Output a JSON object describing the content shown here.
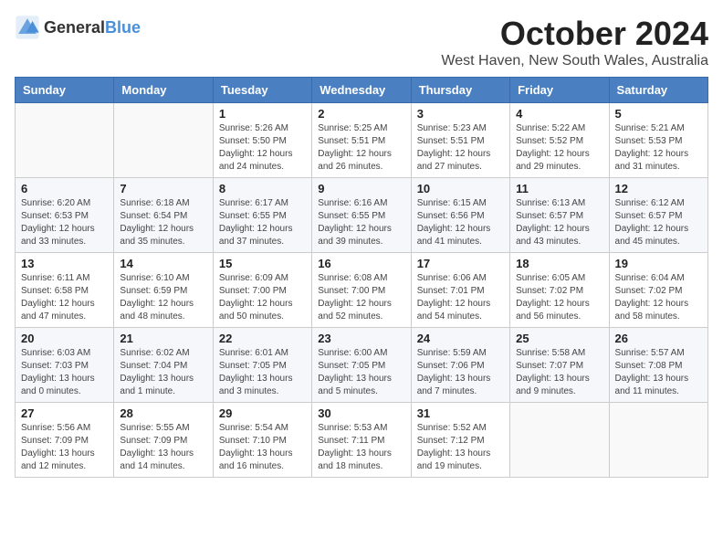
{
  "logo": {
    "text_general": "General",
    "text_blue": "Blue"
  },
  "header": {
    "month_title": "October 2024",
    "location": "West Haven, New South Wales, Australia"
  },
  "days_of_week": [
    "Sunday",
    "Monday",
    "Tuesday",
    "Wednesday",
    "Thursday",
    "Friday",
    "Saturday"
  ],
  "weeks": [
    [
      {
        "day": "",
        "info": ""
      },
      {
        "day": "",
        "info": ""
      },
      {
        "day": "1",
        "info": "Sunrise: 5:26 AM\nSunset: 5:50 PM\nDaylight: 12 hours and 24 minutes."
      },
      {
        "day": "2",
        "info": "Sunrise: 5:25 AM\nSunset: 5:51 PM\nDaylight: 12 hours and 26 minutes."
      },
      {
        "day": "3",
        "info": "Sunrise: 5:23 AM\nSunset: 5:51 PM\nDaylight: 12 hours and 27 minutes."
      },
      {
        "day": "4",
        "info": "Sunrise: 5:22 AM\nSunset: 5:52 PM\nDaylight: 12 hours and 29 minutes."
      },
      {
        "day": "5",
        "info": "Sunrise: 5:21 AM\nSunset: 5:53 PM\nDaylight: 12 hours and 31 minutes."
      }
    ],
    [
      {
        "day": "6",
        "info": "Sunrise: 6:20 AM\nSunset: 6:53 PM\nDaylight: 12 hours and 33 minutes."
      },
      {
        "day": "7",
        "info": "Sunrise: 6:18 AM\nSunset: 6:54 PM\nDaylight: 12 hours and 35 minutes."
      },
      {
        "day": "8",
        "info": "Sunrise: 6:17 AM\nSunset: 6:55 PM\nDaylight: 12 hours and 37 minutes."
      },
      {
        "day": "9",
        "info": "Sunrise: 6:16 AM\nSunset: 6:55 PM\nDaylight: 12 hours and 39 minutes."
      },
      {
        "day": "10",
        "info": "Sunrise: 6:15 AM\nSunset: 6:56 PM\nDaylight: 12 hours and 41 minutes."
      },
      {
        "day": "11",
        "info": "Sunrise: 6:13 AM\nSunset: 6:57 PM\nDaylight: 12 hours and 43 minutes."
      },
      {
        "day": "12",
        "info": "Sunrise: 6:12 AM\nSunset: 6:57 PM\nDaylight: 12 hours and 45 minutes."
      }
    ],
    [
      {
        "day": "13",
        "info": "Sunrise: 6:11 AM\nSunset: 6:58 PM\nDaylight: 12 hours and 47 minutes."
      },
      {
        "day": "14",
        "info": "Sunrise: 6:10 AM\nSunset: 6:59 PM\nDaylight: 12 hours and 48 minutes."
      },
      {
        "day": "15",
        "info": "Sunrise: 6:09 AM\nSunset: 7:00 PM\nDaylight: 12 hours and 50 minutes."
      },
      {
        "day": "16",
        "info": "Sunrise: 6:08 AM\nSunset: 7:00 PM\nDaylight: 12 hours and 52 minutes."
      },
      {
        "day": "17",
        "info": "Sunrise: 6:06 AM\nSunset: 7:01 PM\nDaylight: 12 hours and 54 minutes."
      },
      {
        "day": "18",
        "info": "Sunrise: 6:05 AM\nSunset: 7:02 PM\nDaylight: 12 hours and 56 minutes."
      },
      {
        "day": "19",
        "info": "Sunrise: 6:04 AM\nSunset: 7:02 PM\nDaylight: 12 hours and 58 minutes."
      }
    ],
    [
      {
        "day": "20",
        "info": "Sunrise: 6:03 AM\nSunset: 7:03 PM\nDaylight: 13 hours and 0 minutes."
      },
      {
        "day": "21",
        "info": "Sunrise: 6:02 AM\nSunset: 7:04 PM\nDaylight: 13 hours and 1 minute."
      },
      {
        "day": "22",
        "info": "Sunrise: 6:01 AM\nSunset: 7:05 PM\nDaylight: 13 hours and 3 minutes."
      },
      {
        "day": "23",
        "info": "Sunrise: 6:00 AM\nSunset: 7:05 PM\nDaylight: 13 hours and 5 minutes."
      },
      {
        "day": "24",
        "info": "Sunrise: 5:59 AM\nSunset: 7:06 PM\nDaylight: 13 hours and 7 minutes."
      },
      {
        "day": "25",
        "info": "Sunrise: 5:58 AM\nSunset: 7:07 PM\nDaylight: 13 hours and 9 minutes."
      },
      {
        "day": "26",
        "info": "Sunrise: 5:57 AM\nSunset: 7:08 PM\nDaylight: 13 hours and 11 minutes."
      }
    ],
    [
      {
        "day": "27",
        "info": "Sunrise: 5:56 AM\nSunset: 7:09 PM\nDaylight: 13 hours and 12 minutes."
      },
      {
        "day": "28",
        "info": "Sunrise: 5:55 AM\nSunset: 7:09 PM\nDaylight: 13 hours and 14 minutes."
      },
      {
        "day": "29",
        "info": "Sunrise: 5:54 AM\nSunset: 7:10 PM\nDaylight: 13 hours and 16 minutes."
      },
      {
        "day": "30",
        "info": "Sunrise: 5:53 AM\nSunset: 7:11 PM\nDaylight: 13 hours and 18 minutes."
      },
      {
        "day": "31",
        "info": "Sunrise: 5:52 AM\nSunset: 7:12 PM\nDaylight: 13 hours and 19 minutes."
      },
      {
        "day": "",
        "info": ""
      },
      {
        "day": "",
        "info": ""
      }
    ]
  ]
}
